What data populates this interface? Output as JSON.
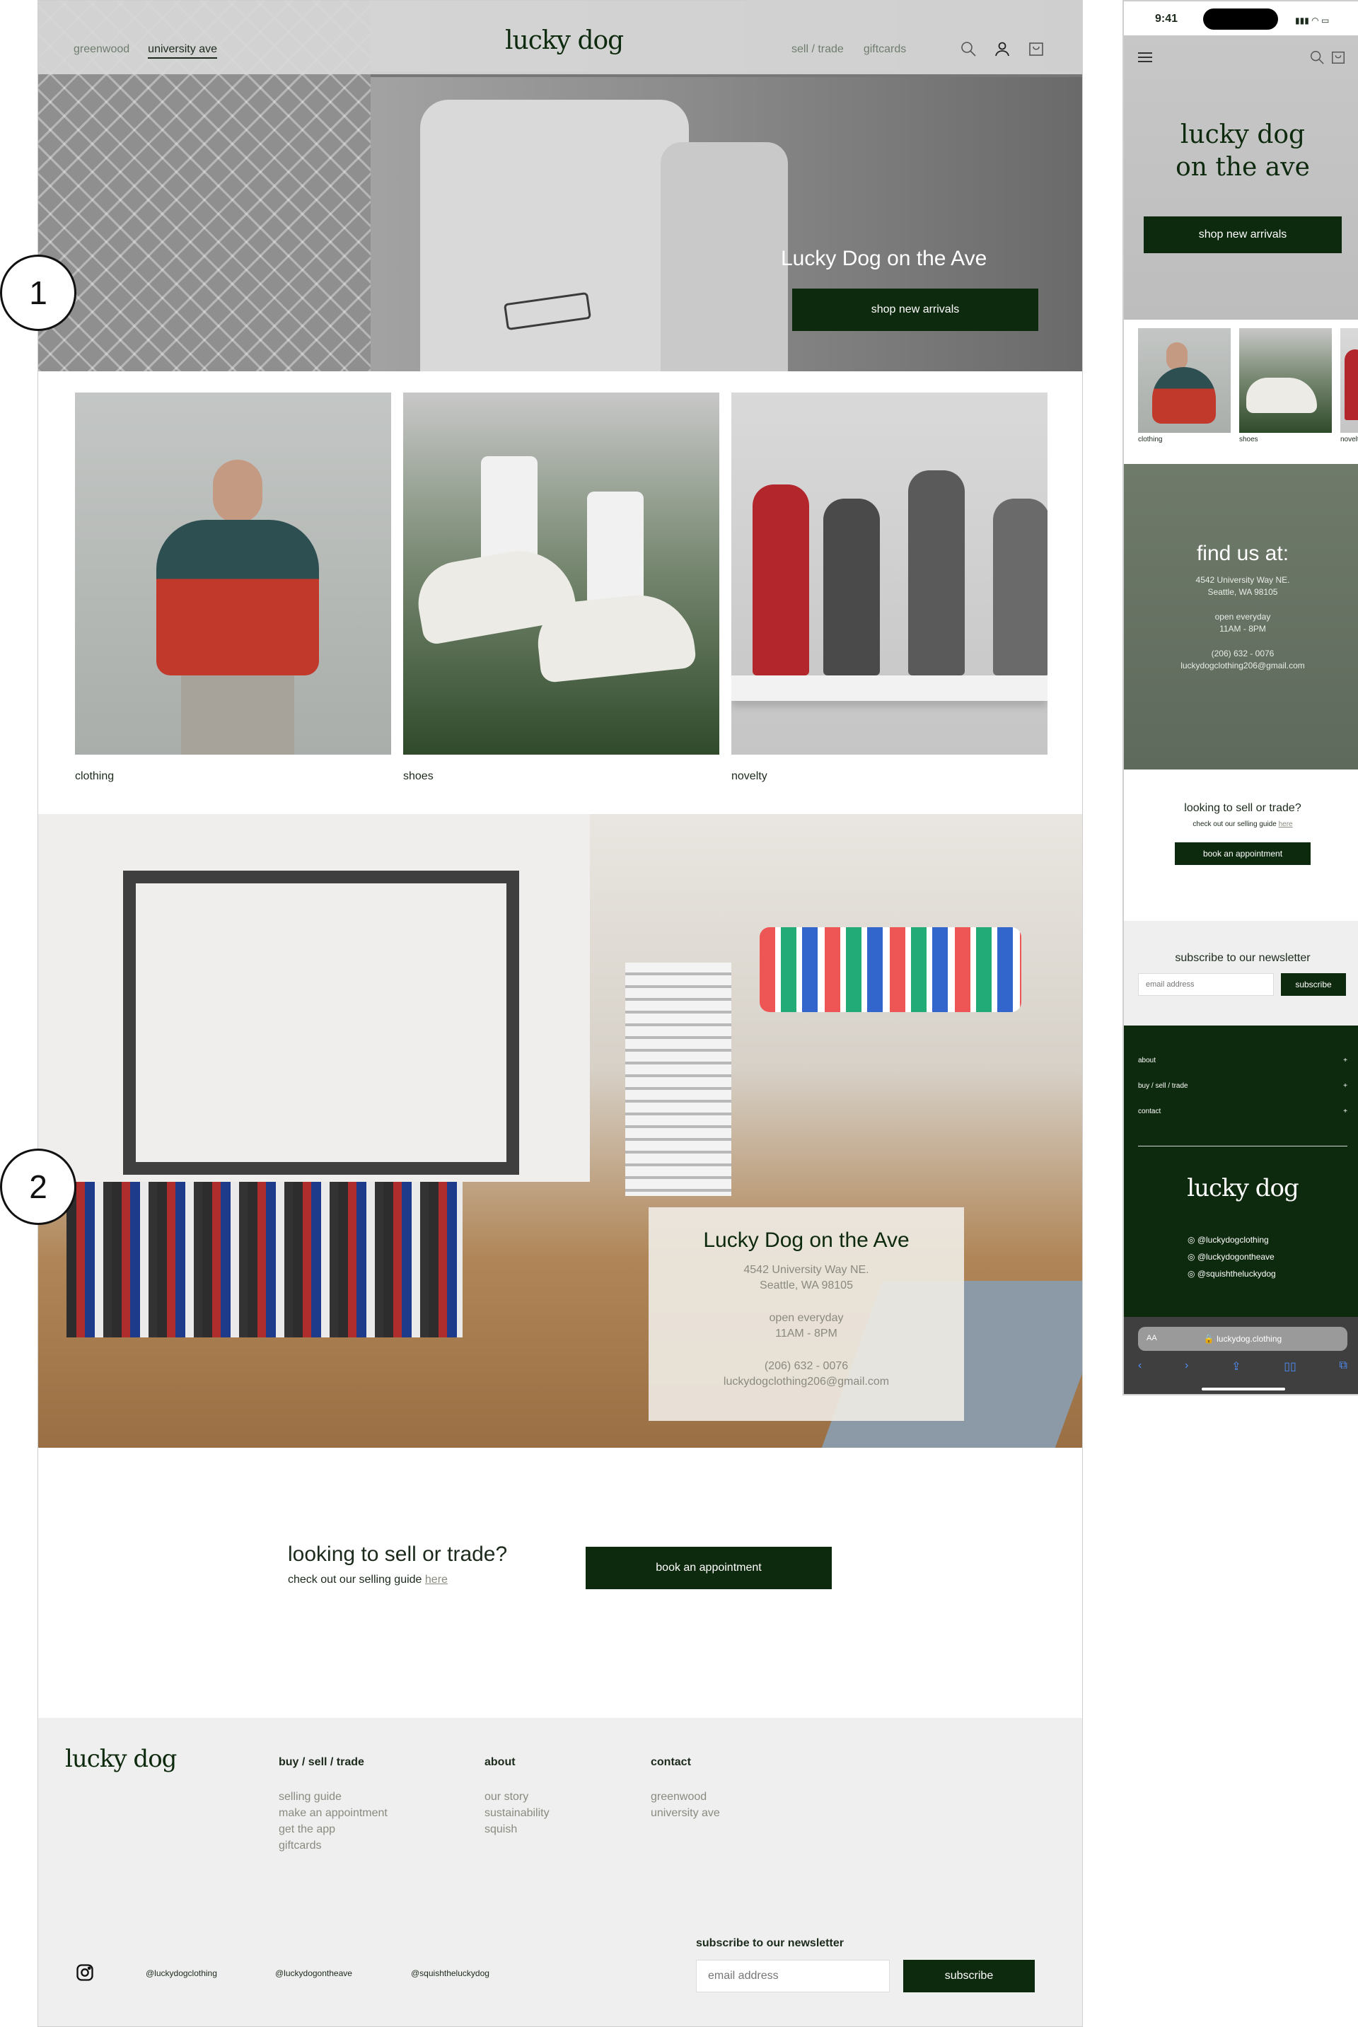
{
  "desktop": {
    "header": {
      "nav_left": [
        "greenwood",
        "university ave"
      ],
      "brand": "lucky dog",
      "nav_right": [
        "sell / trade",
        "giftcards"
      ],
      "icons": [
        "search-icon",
        "account-icon",
        "cart-icon"
      ]
    },
    "hero": {
      "title": "Lucky Dog on the Ave",
      "cta": "shop new arrivals"
    },
    "categories": [
      "clothing",
      "shoes",
      "novelty"
    ],
    "store": {
      "title": "Lucky Dog on the Ave",
      "address_line1": "4542 University Way NE.",
      "address_line2": "Seattle, WA 98105",
      "hours_line1": "open everyday",
      "hours_line2": "11AM - 8PM",
      "phone": "(206) 632 - 0076",
      "email": "luckydogclothing206@gmail.com"
    },
    "sell": {
      "question": "looking to sell or trade?",
      "sub": "check out our selling guide",
      "link": "here",
      "cta": "book an appointment"
    },
    "footer": {
      "brand": "lucky dog",
      "col1": {
        "heading": "buy / sell / trade",
        "items": [
          "selling guide",
          "make an appointment",
          "get the app",
          "giftcards"
        ]
      },
      "col2": {
        "heading": "about",
        "items": [
          "our story",
          "sustainability",
          "squish"
        ]
      },
      "col3": {
        "heading": "contact",
        "items": [
          "greenwood",
          "university ave"
        ]
      },
      "handles": [
        "@luckydogclothing",
        "@luckydogontheave",
        "@squishtheluckydog"
      ],
      "newsletter_heading": "subscribe to our newsletter",
      "email_placeholder": "email address",
      "subscribe": "subscribe"
    },
    "annotations": [
      "1",
      "2"
    ]
  },
  "mobile": {
    "status_time": "9:41",
    "hero": {
      "line1": "lucky dog",
      "line2": "on the ave",
      "cta": "shop new arrivals"
    },
    "categories": [
      "clothing",
      "shoes",
      "novelt"
    ],
    "find": {
      "title": "find us at:",
      "address_line1": "4542 University Way NE.",
      "address_line2": "Seattle, WA 98105",
      "hours_line1": "open everyday",
      "hours_line2": "11AM - 8PM",
      "phone": "(206) 632 - 0076",
      "email": "luckydogclothing206@gmail.com"
    },
    "sell": {
      "question": "looking to sell or trade?",
      "sub": "check out our selling guide",
      "link": "here",
      "cta": "book an appointment"
    },
    "newsletter": {
      "title": "subscribe to our newsletter",
      "placeholder": "email address",
      "cta": "subscribe"
    },
    "footer": {
      "accordion": [
        "about",
        "buy / sell / trade",
        "contact"
      ],
      "brand": "lucky dog",
      "handles": [
        "@luckydogclothing",
        "@luckydogontheave",
        "@squishtheluckydog"
      ]
    },
    "browser": {
      "aa": "AA",
      "url": "luckydog.clothing"
    }
  },
  "colors": {
    "brand_green": "#0e2a0e",
    "muted_text": "#8a8a80",
    "footer_bg": "#efefef"
  }
}
